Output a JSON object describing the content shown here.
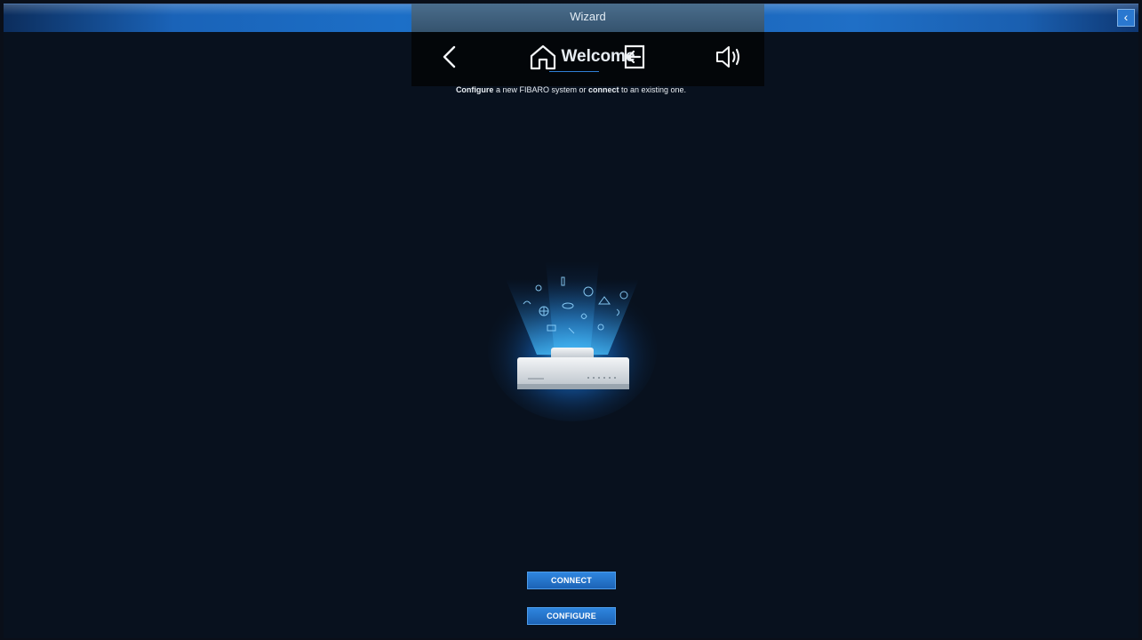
{
  "header": {
    "wizard_title": "Wizard",
    "corner_back_glyph": "‹"
  },
  "nav": {
    "back_icon": "chevron-left-icon",
    "home_icon": "home-icon",
    "title": "Welcome",
    "exit_icon": "exit-icon",
    "sound_icon": "speaker-icon"
  },
  "subtitle": {
    "part1": "Configure",
    "part2": " a new FIBARO system or ",
    "part3": "connect",
    "part4": " to an existing one."
  },
  "buttons": {
    "connect": "CONNECT",
    "configure": "CONFIGURE"
  },
  "colors": {
    "accent": "#1c6fc7",
    "background": "#08111e",
    "button": "#2478cc"
  }
}
